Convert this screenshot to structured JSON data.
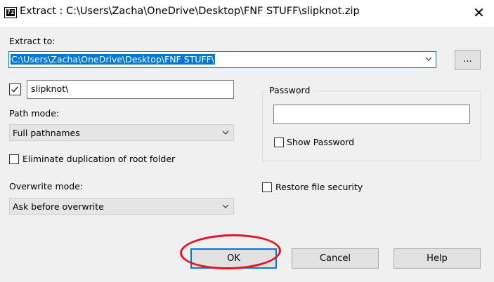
{
  "window": {
    "title": "Extract : C:\\Users\\Zacha\\OneDrive\\Desktop\\FNF STUFF\\slipknot.zip",
    "app_icon_text": "7z",
    "close_symbol": "✕"
  },
  "extract_to": {
    "label": "Extract to:",
    "value": "C:\\Users\\Zacha\\OneDrive\\Desktop\\FNF STUFF\\",
    "browse_label": "..."
  },
  "subfolder": {
    "checked": true,
    "value": "slipknot\\"
  },
  "path_mode": {
    "label": "Path mode:",
    "selected": "Full pathnames"
  },
  "eliminate_duplication": {
    "label": "Eliminate duplication of root folder",
    "checked": false
  },
  "overwrite_mode": {
    "label": "Overwrite mode:",
    "selected": "Ask before overwrite"
  },
  "password": {
    "group_label": "Password",
    "value": "",
    "show_password_label": "Show Password",
    "show_password_checked": false
  },
  "restore_security": {
    "label": "Restore file security",
    "checked": false
  },
  "buttons": {
    "ok": "OK",
    "cancel": "Cancel",
    "help": "Help"
  },
  "colors": {
    "selection": "#0078d7",
    "annotation": "#e8121f",
    "window_bg": "#f0f0f0"
  }
}
